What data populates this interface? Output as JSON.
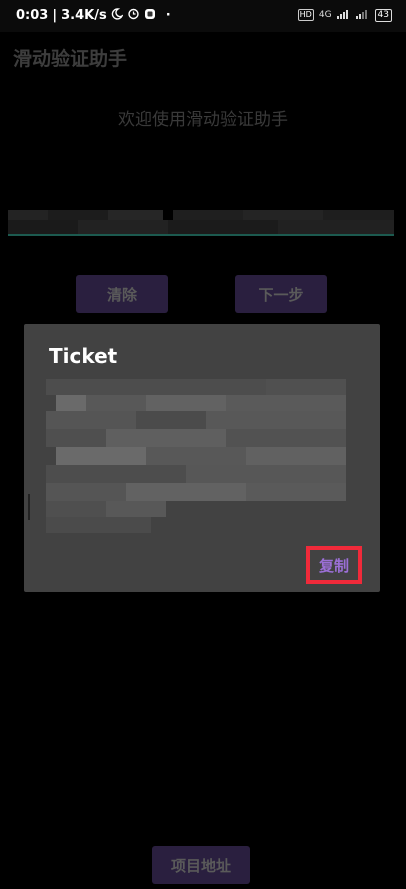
{
  "status_bar": {
    "time": "0:03",
    "speed": "3.4K/s",
    "dot": "·",
    "hd": "HD",
    "network": "4G",
    "battery": "43"
  },
  "app": {
    "title": "滑动验证助手",
    "welcome": "欢迎使用滑动验证助手",
    "clear_label": "清除",
    "next_label": "下一步",
    "project_label": "项目地址"
  },
  "dialog": {
    "title": "Ticket",
    "copy_label": "复制"
  },
  "colors": {
    "background": "#000000",
    "dialog_bg": "#424242",
    "button_bg": "#2a1f3f",
    "accent_purple": "#9b6fd6",
    "highlight_red": "#f02a3a",
    "underline_teal": "#1c5a4f"
  }
}
